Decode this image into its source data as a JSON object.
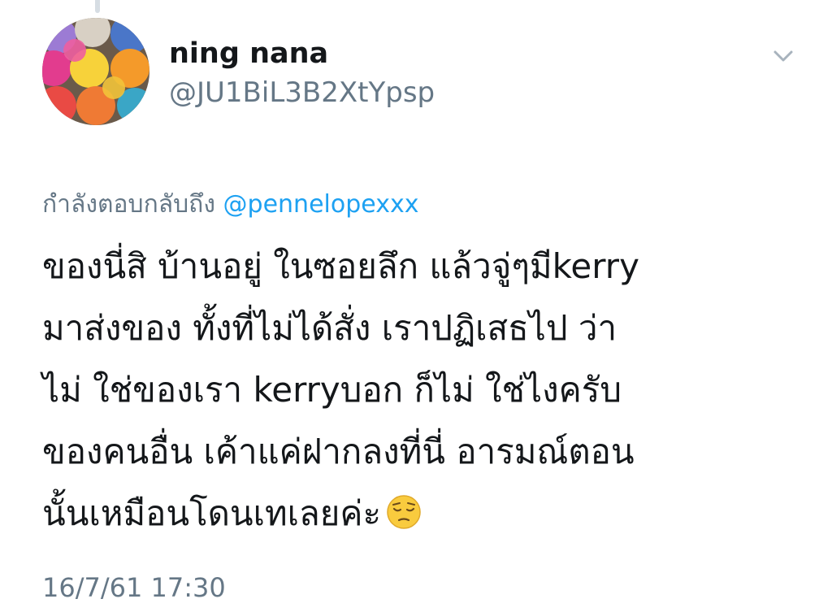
{
  "user": {
    "display_name": "ning nana",
    "handle": "@JU1BiL3B2XtYpsp",
    "avatar_icon": "avatar-yarn-balls"
  },
  "reply": {
    "prefix": "กำลังตอบกลับถึง",
    "mention": "@pennelopexxx"
  },
  "tweet": {
    "lines": [
      "ของนี่สิ บ้านอยู่ ในซอยลึก แล้วจู่ๆมีkerry",
      "มาส่งของ ทั้งที่ไม่ได้สั่ง เราปฏิเสธไป ว่า",
      "ไม่ ใช่ของเรา kerryบอก ก็ไม่ ใช่ไงครับ",
      "ของคนอื่น เค้าแค่ฝากลงที่นี่ อารมณ์ตอน",
      "นั้นเหมือนโดนเทเลยค่ะ"
    ],
    "emoji": "pensive-face-emoji",
    "timestamp": "16/7/61 17:30"
  },
  "colors": {
    "text": "#14171a",
    "secondary": "#657786",
    "link": "#1da1f2"
  }
}
